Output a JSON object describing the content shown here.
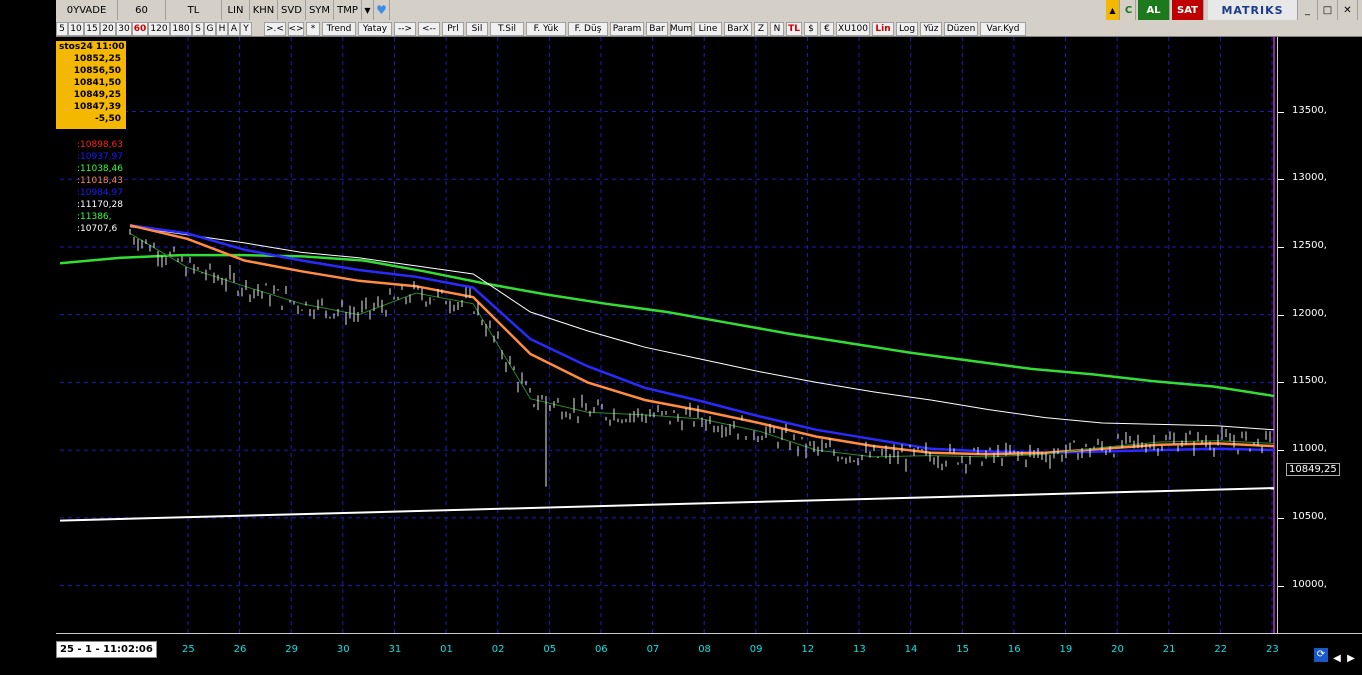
{
  "toolbar1": {
    "items": [
      "0YVADE",
      "60",
      "TL",
      "LIN",
      "KHN",
      "SVD",
      "SYM",
      "TMP"
    ],
    "dropdown_icon": "chevron-down-icon",
    "tweet_icon": "bird-icon",
    "al_label": "AL",
    "sat_label": "SAT",
    "logo": "MATRIKS",
    "window_controls": [
      "_",
      "□",
      "✕"
    ]
  },
  "toolbar2": {
    "periods": [
      "5",
      "10",
      "15",
      "20",
      "30",
      "60",
      "120",
      "180",
      "S",
      "G",
      "H",
      "A",
      "Y"
    ],
    "selected_period": "60",
    "tools": [
      ">.<",
      "<>",
      "*",
      "Trend",
      "Yatay",
      "-->",
      "<--",
      "Prl",
      "Sil",
      "T.Sil",
      "F. Yük",
      "F. Düş",
      "Param",
      "Bar",
      "Mum",
      "Line",
      "BarX",
      "Z",
      "N",
      "TL",
      "$",
      "€",
      "XU100",
      "Lin",
      "Log",
      "Yüz",
      "Düzen",
      "Var.Kyd"
    ],
    "red_tools": [
      "TL",
      "Lin"
    ]
  },
  "info_box": {
    "date": "stos24 11:00",
    "open": "10852,25",
    "high": "10856,50",
    "low": "10841,50",
    "close": "10849,25",
    "avg": "10847,39",
    "change": "-5,50"
  },
  "ma_labels": [
    {
      "text": ":10898,63",
      "color": "#ff2020"
    },
    {
      "text": ":10937,97",
      "color": "#1a1aff"
    },
    {
      "text": ":11038,46",
      "color": "#33ff33"
    },
    {
      "text": ":11018,43",
      "color": "#ff8c40"
    },
    {
      "text": ":10984,97",
      "color": "#1a1aff"
    },
    {
      "text": ":11170,28",
      "color": "#ffffff"
    },
    {
      "text": ":11386,",
      "color": "#33ff33"
    },
    {
      "text": ":10707,6",
      "color": "#ffffff"
    }
  ],
  "chart_data": {
    "type": "line",
    "y_ticks": [
      "13500,",
      "13000,",
      "12500,",
      "12000,",
      "11500,",
      "11000,",
      "10500,",
      "10000,"
    ],
    "y_tick_values": [
      13500,
      13000,
      12500,
      12000,
      11500,
      11000,
      10500,
      10000
    ],
    "ylim": [
      9650,
      14050
    ],
    "last_price_label": "10849,25",
    "last_price": 10849.25,
    "x_ticks": [
      "25",
      "26",
      "29",
      "30",
      "31",
      "01",
      "02",
      "05",
      "06",
      "07",
      "08",
      "09",
      "12",
      "13",
      "14",
      "15",
      "16",
      "19",
      "20",
      "21",
      "22",
      "23"
    ],
    "series": [
      {
        "color": "#33dd33",
        "values": [
          12380,
          12420,
          12440,
          12440,
          12430,
          12400,
          12320,
          12230,
          12150,
          12080,
          12020,
          11940,
          11860,
          11790,
          11720,
          11660,
          11600,
          11560,
          11510,
          11470,
          11400
        ]
      },
      {
        "color": "#ffffff",
        "values": [
          12650,
          12590,
          12530,
          12460,
          12420,
          12360,
          12300,
          12020,
          11880,
          11760,
          11670,
          11580,
          11500,
          11430,
          11370,
          11300,
          11240,
          11200,
          11190,
          11180,
          11150
        ]
      },
      {
        "color": "#2a2aff",
        "values": [
          12660,
          12600,
          12480,
          12400,
          12330,
          12280,
          12200,
          11820,
          11620,
          11460,
          11360,
          11250,
          11150,
          11080,
          11010,
          10990,
          10980,
          10990,
          11000,
          11010,
          11000
        ]
      },
      {
        "color": "#ff8c40",
        "values": [
          12660,
          12560,
          12400,
          12320,
          12250,
          12210,
          12130,
          11710,
          11500,
          11370,
          11290,
          11200,
          11100,
          11030,
          10980,
          10970,
          10980,
          11010,
          11040,
          11050,
          11030
        ]
      },
      {
        "color": "#2a8a2a",
        "values": [
          12600,
          12350,
          12210,
          12080,
          12000,
          12160,
          12080,
          11380,
          11280,
          11260,
          11230,
          11140,
          11000,
          10950,
          10960,
          10950,
          10970,
          11020,
          11060,
          11070,
          11050
        ]
      }
    ],
    "trendline_start": 10480,
    "trendline_end": 10720
  },
  "time_label": "25 - 1 - 11:02:06"
}
